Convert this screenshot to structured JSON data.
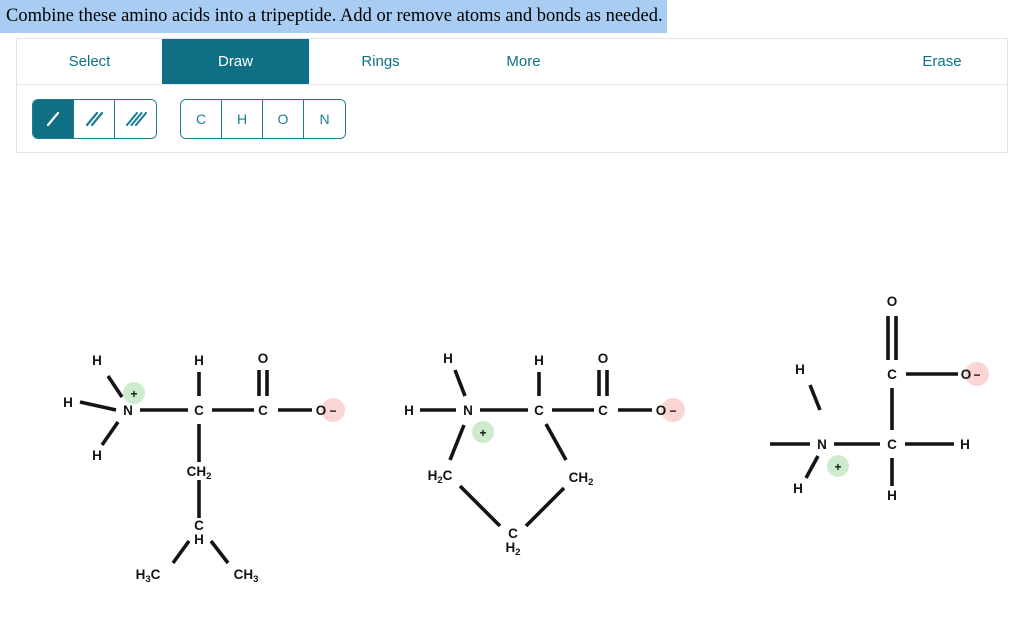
{
  "prompt": {
    "text": "Combine these amino acids into a tripeptide. Add or remove atoms and bonds as needed.",
    "highlight_color": "#a9cdf2"
  },
  "toolbar": {
    "accent_color": "#0f6f84",
    "tabs": [
      {
        "label": "Select",
        "active": false
      },
      {
        "label": "Draw",
        "active": true
      },
      {
        "label": "Rings",
        "active": false
      },
      {
        "label": "More",
        "active": false
      },
      {
        "label": "Erase",
        "active": false
      }
    ],
    "bond_tools": [
      {
        "name": "single-bond",
        "label": "/",
        "active": true
      },
      {
        "name": "double-bond",
        "label": "//",
        "active": false
      },
      {
        "name": "triple-bond",
        "label": "///",
        "active": false
      }
    ],
    "element_tools": [
      {
        "label": "C",
        "active": false
      },
      {
        "label": "H",
        "active": false
      },
      {
        "label": "O",
        "active": false
      },
      {
        "label": "N",
        "active": false
      }
    ]
  },
  "canvas": {
    "charge_positive": "+",
    "charge_negative": "−",
    "charge_positive_color": "#cdeccd",
    "charge_negative_color": "#fbd4d4",
    "molecules": [
      {
        "name": "leucine",
        "atoms": [
          "H",
          "H",
          "H",
          "N",
          "H",
          "C",
          "O",
          "C",
          "O",
          "CH2",
          "C",
          "H",
          "H3C",
          "CH3"
        ],
        "charges": [
          "+",
          "−"
        ]
      },
      {
        "name": "proline",
        "atoms": [
          "H",
          "H",
          "N",
          "H",
          "C",
          "O",
          "C",
          "O",
          "H2C",
          "CH2",
          "C",
          "H2"
        ],
        "charges": [
          "+",
          "−"
        ]
      },
      {
        "name": "glycine",
        "atoms": [
          "O",
          "C",
          "O",
          "H",
          "N",
          "C",
          "H",
          "H",
          "H",
          "H"
        ],
        "charges": [
          "+",
          "−"
        ]
      }
    ]
  }
}
